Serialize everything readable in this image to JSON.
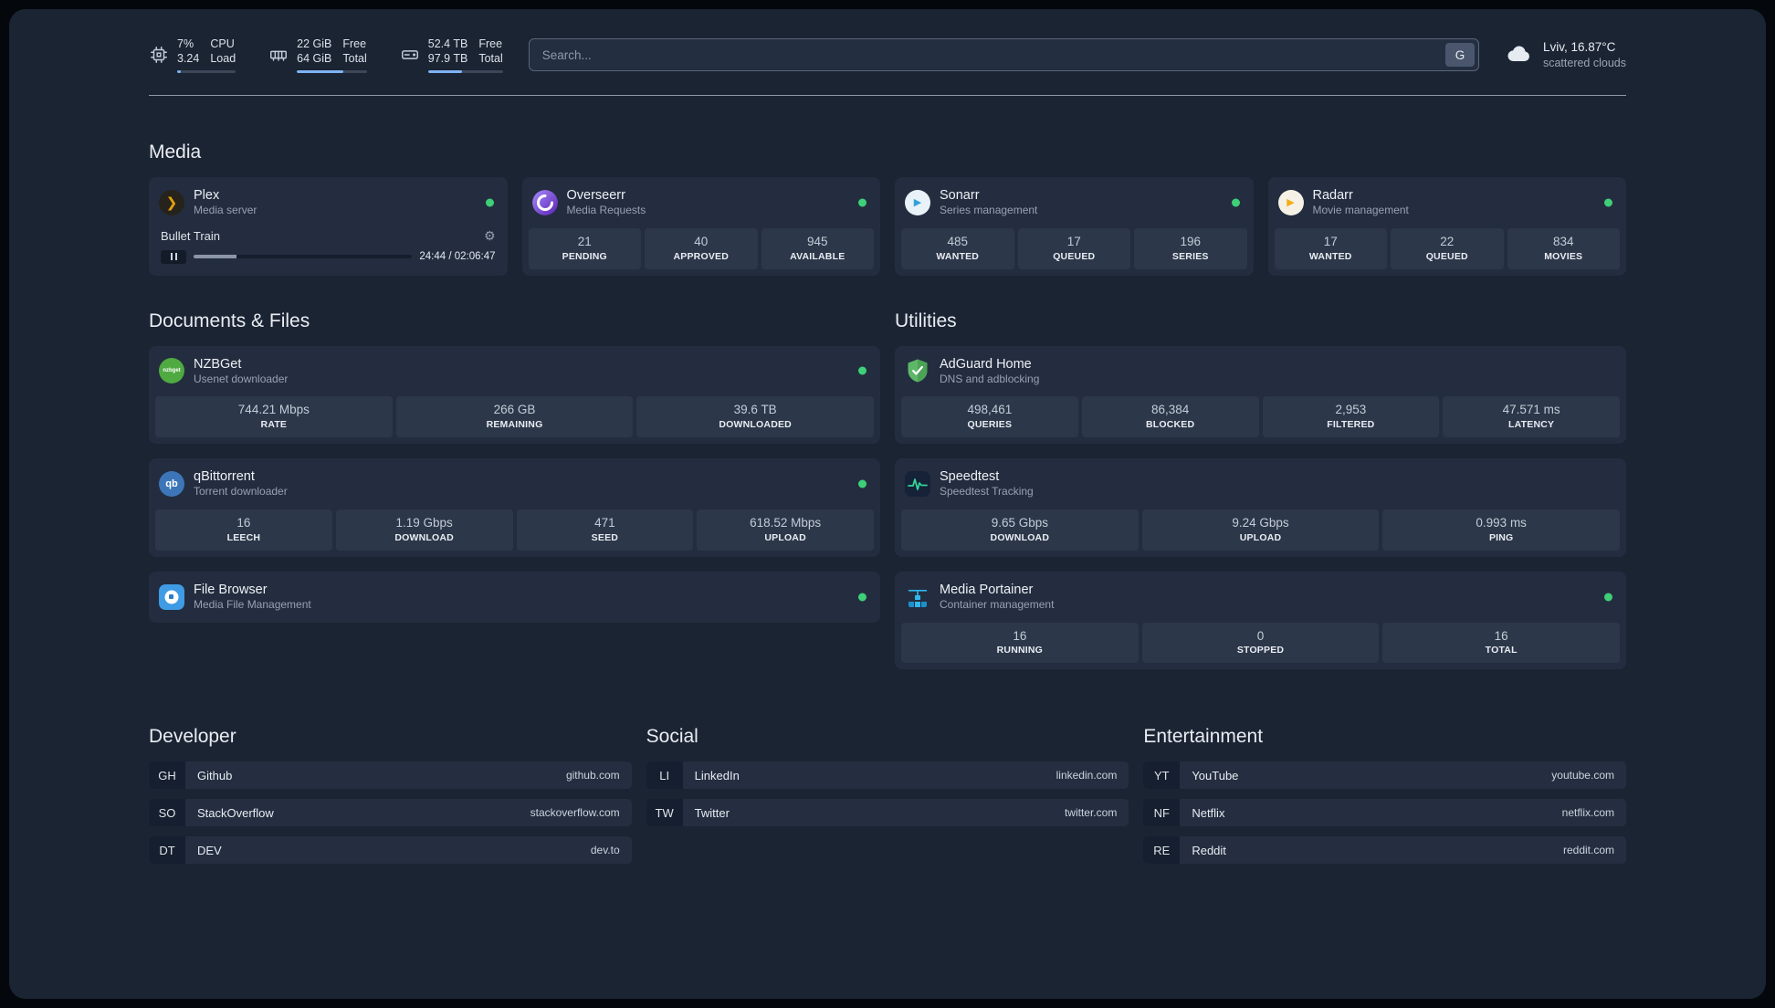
{
  "topbar": {
    "cpu": {
      "percent": "7%",
      "load": "3.24",
      "percent_label": "CPU",
      "load_label": "Load",
      "bar_percent": 7
    },
    "memory": {
      "free": "22 GiB",
      "total": "64 GiB",
      "free_label": "Free",
      "total_label": "Total",
      "bar_percent": 66
    },
    "disk": {
      "free": "52.4 TB",
      "total": "97.9 TB",
      "free_label": "Free",
      "total_label": "Total",
      "bar_percent": 46
    },
    "search": {
      "placeholder": "Search...",
      "provider_button": "G"
    },
    "weather": {
      "location": "Lviv, 16.87°C",
      "condition": "scattered clouds"
    }
  },
  "sections": {
    "media": "Media",
    "documents": "Documents & Files",
    "utilities": "Utilities",
    "developer": "Developer",
    "social": "Social",
    "entertainment": "Entertainment"
  },
  "services": {
    "plex": {
      "name": "Plex",
      "desc": "Media server",
      "now_playing": "Bullet Train",
      "time": "24:44 / 02:06:47",
      "progress_percent": 19.5
    },
    "overseerr": {
      "name": "Overseerr",
      "desc": "Media Requests",
      "stats": [
        {
          "value": "21",
          "label": "PENDING"
        },
        {
          "value": "40",
          "label": "APPROVED"
        },
        {
          "value": "945",
          "label": "AVAILABLE"
        }
      ]
    },
    "sonarr": {
      "name": "Sonarr",
      "desc": "Series management",
      "stats": [
        {
          "value": "485",
          "label": "WANTED"
        },
        {
          "value": "17",
          "label": "QUEUED"
        },
        {
          "value": "196",
          "label": "SERIES"
        }
      ]
    },
    "radarr": {
      "name": "Radarr",
      "desc": "Movie management",
      "stats": [
        {
          "value": "17",
          "label": "WANTED"
        },
        {
          "value": "22",
          "label": "QUEUED"
        },
        {
          "value": "834",
          "label": "MOVIES"
        }
      ]
    },
    "nzbget": {
      "name": "NZBGet",
      "desc": "Usenet downloader",
      "stats": [
        {
          "value": "744.21 Mbps",
          "label": "RATE"
        },
        {
          "value": "266 GB",
          "label": "REMAINING"
        },
        {
          "value": "39.6 TB",
          "label": "DOWNLOADED"
        }
      ]
    },
    "qbittorrent": {
      "name": "qBittorrent",
      "desc": "Torrent downloader",
      "stats": [
        {
          "value": "16",
          "label": "LEECH"
        },
        {
          "value": "1.19 Gbps",
          "label": "DOWNLOAD"
        },
        {
          "value": "471",
          "label": "SEED"
        },
        {
          "value": "618.52 Mbps",
          "label": "UPLOAD"
        }
      ]
    },
    "filebrowser": {
      "name": "File Browser",
      "desc": "Media File Management"
    },
    "adguard": {
      "name": "AdGuard Home",
      "desc": "DNS and adblocking",
      "stats": [
        {
          "value": "498,461",
          "label": "QUERIES"
        },
        {
          "value": "86,384",
          "label": "BLOCKED"
        },
        {
          "value": "2,953",
          "label": "FILTERED"
        },
        {
          "value": "47.571 ms",
          "label": "LATENCY"
        }
      ]
    },
    "speedtest": {
      "name": "Speedtest",
      "desc": "Speedtest Tracking",
      "stats": [
        {
          "value": "9.65 Gbps",
          "label": "DOWNLOAD"
        },
        {
          "value": "9.24 Gbps",
          "label": "UPLOAD"
        },
        {
          "value": "0.993 ms",
          "label": "PING"
        }
      ]
    },
    "portainer": {
      "name": "Media Portainer",
      "desc": "Container management",
      "stats": [
        {
          "value": "16",
          "label": "RUNNING"
        },
        {
          "value": "0",
          "label": "STOPPED"
        },
        {
          "value": "16",
          "label": "TOTAL"
        }
      ]
    }
  },
  "icons": {
    "nzbget_text": "nzbget",
    "qbit_text": "qb",
    "plex_chevron": "❯",
    "play_glyph": "▶",
    "gear_glyph": "⚙"
  },
  "bookmarks": {
    "developer": [
      {
        "abbr": "GH",
        "name": "Github",
        "url": "github.com"
      },
      {
        "abbr": "SO",
        "name": "StackOverflow",
        "url": "stackoverflow.com"
      },
      {
        "abbr": "DT",
        "name": "DEV",
        "url": "dev.to"
      }
    ],
    "social": [
      {
        "abbr": "LI",
        "name": "LinkedIn",
        "url": "linkedin.com"
      },
      {
        "abbr": "TW",
        "name": "Twitter",
        "url": "twitter.com"
      }
    ],
    "entertainment": [
      {
        "abbr": "YT",
        "name": "YouTube",
        "url": "youtube.com"
      },
      {
        "abbr": "NF",
        "name": "Netflix",
        "url": "netflix.com"
      },
      {
        "abbr": "RE",
        "name": "Reddit",
        "url": "reddit.com"
      }
    ]
  }
}
